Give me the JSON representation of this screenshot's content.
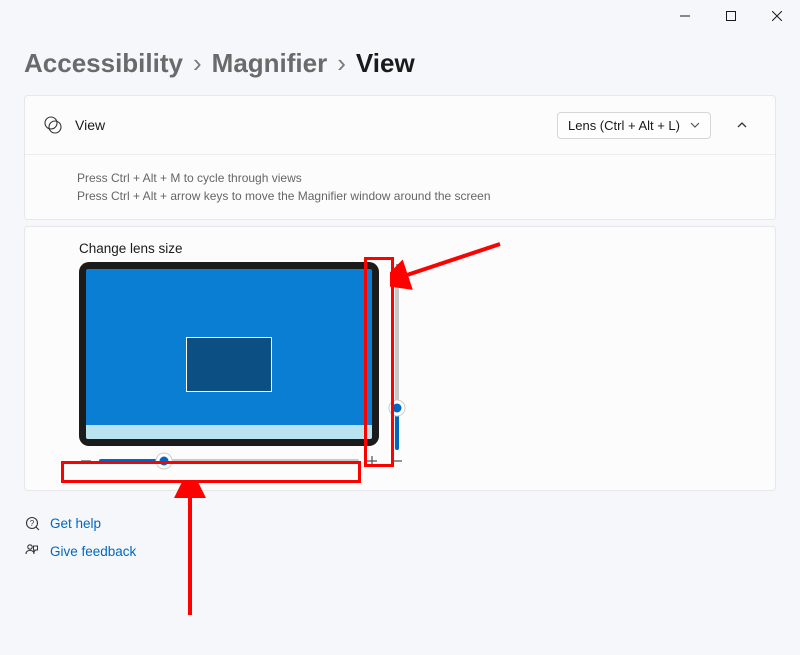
{
  "breadcrumb": {
    "items": [
      "Accessibility",
      "Magnifier",
      "View"
    ],
    "separator": "›"
  },
  "viewcard": {
    "title": "View",
    "dropdown_value": "Lens (Ctrl + Alt + L)",
    "hint_line1": "Press Ctrl + Alt + M to cycle through views",
    "hint_line2": "Press Ctrl + Alt + arrow keys to move the Magnifier window around the screen"
  },
  "lens": {
    "title": "Change lens size",
    "horizontal_percent": 25,
    "vertical_percent": 25
  },
  "links": {
    "help": "Get help",
    "feedback": "Give feedback"
  },
  "colors": {
    "accent": "#0067c0",
    "annotation": "#ff0000"
  }
}
